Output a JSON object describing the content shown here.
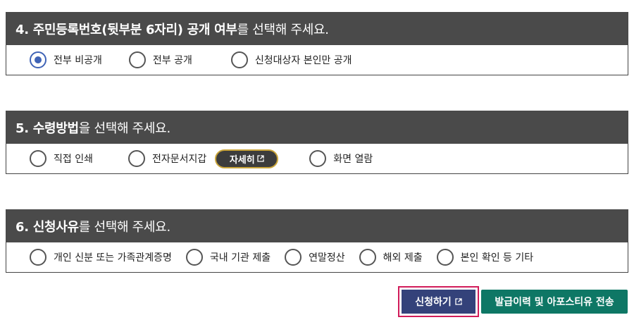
{
  "section4": {
    "title_bold": "4. 주민등록번호(뒷부분 6자리) 공개 여부",
    "title_rest": "를 선택해 주세요.",
    "options": [
      "전부 비공개",
      "전부 공개",
      "신청대상자 본인만 공개"
    ],
    "selected": 0
  },
  "section5": {
    "title_bold": "5. 수령방법",
    "title_rest": "을 선택해 주세요.",
    "options": [
      "직접 인쇄",
      "전자문서지갑",
      "화면 열람"
    ],
    "detail_label": "자세히"
  },
  "section6": {
    "title_bold": "6. 신청사유",
    "title_rest": "를 선택해 주세요.",
    "options": [
      "개인 신분 또는 가족관계증명",
      "국내 기관 제출",
      "연말정산",
      "해외 제출",
      "본인 확인 등 기타"
    ]
  },
  "actions": {
    "apply_label": "신청하기",
    "history_label": "발급이력 및 아포스티유 전송"
  },
  "colors": {
    "header_bg": "#4a4a4a",
    "radio_selected": "#3f63b6",
    "apply_bg": "#34427a",
    "apply_highlight": "#d11c5a",
    "history_bg": "#0e7765",
    "detail_border": "#c9a43a"
  },
  "icons": {
    "external_link": "external-link-icon"
  }
}
